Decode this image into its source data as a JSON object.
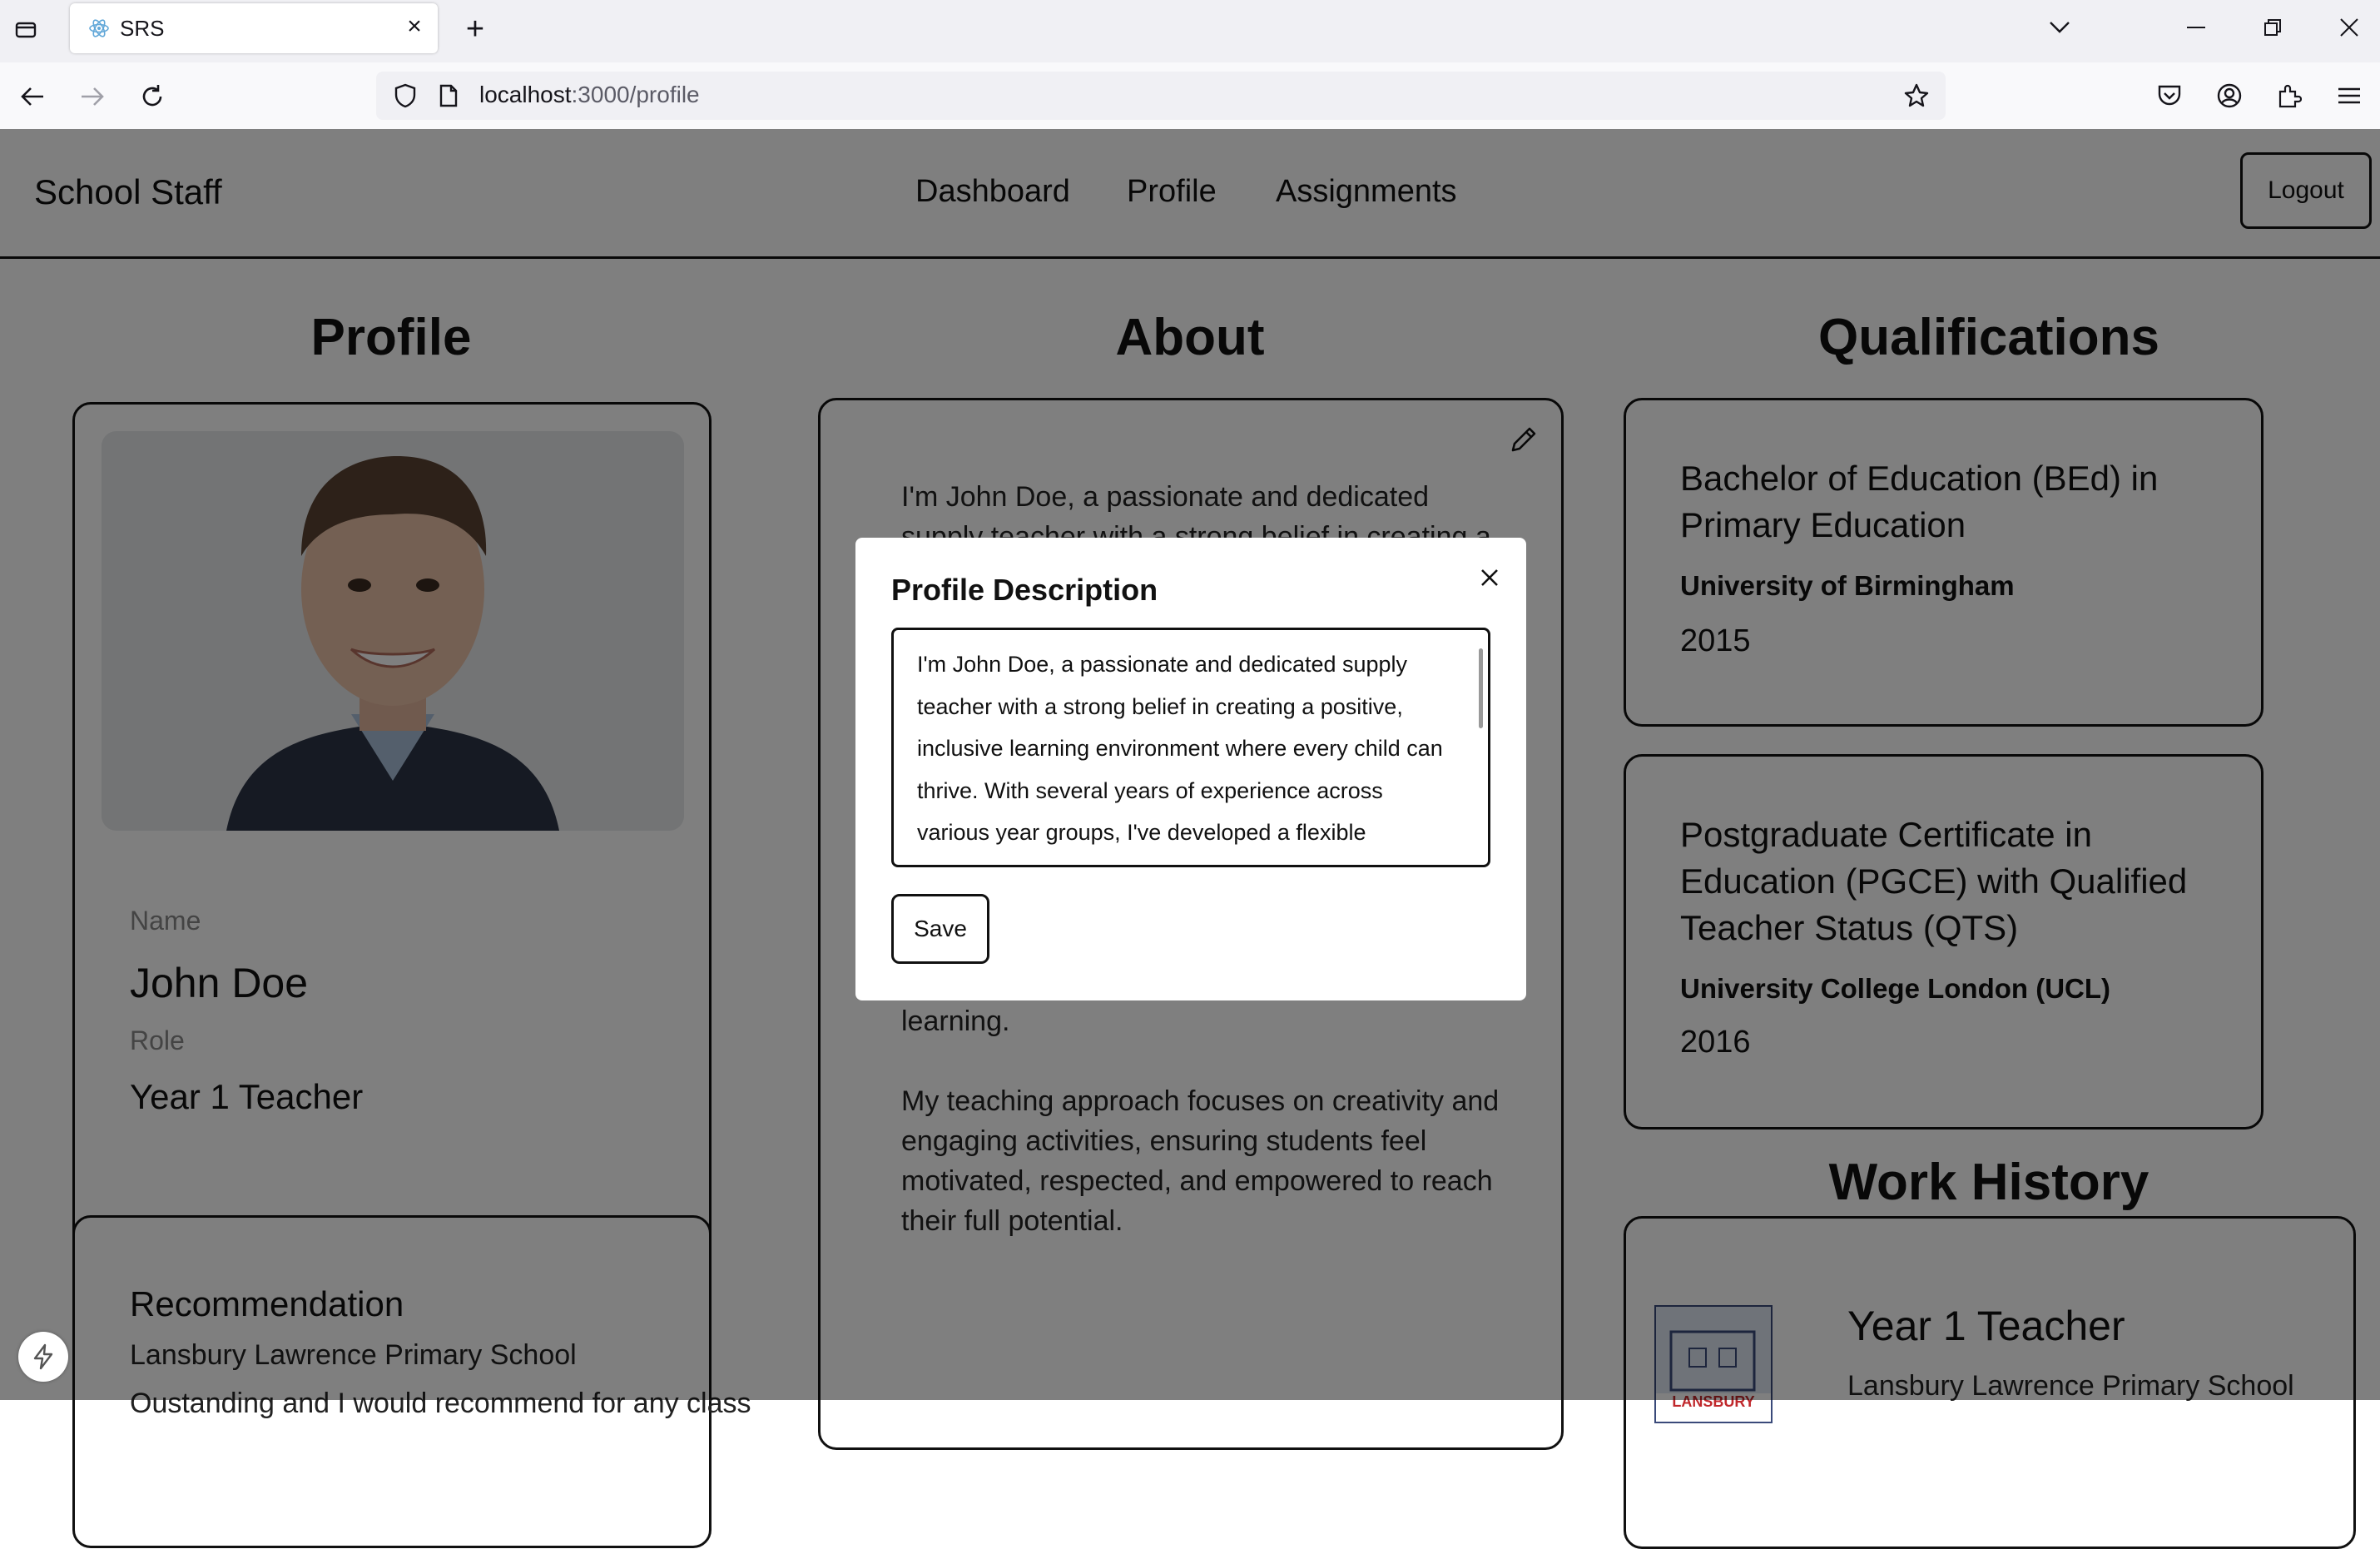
{
  "browser": {
    "tab_title": "SRS",
    "url_host": "localhost",
    "url_path": ":3000/profile"
  },
  "nav": {
    "brand": "School Staff",
    "links": [
      "Dashboard",
      "Profile",
      "Assignments"
    ],
    "logout": "Logout"
  },
  "profile": {
    "heading": "Profile",
    "name_label": "Name",
    "name": "John Doe",
    "role_label": "Role",
    "role": "Year 1 Teacher"
  },
  "recommendation": {
    "heading": "Recommendation",
    "school": "Lansbury Lawrence Primary School",
    "text": "Oustanding and I would recommend for any class"
  },
  "about": {
    "heading": "About",
    "para1_first": "I'm John Doe, a passionate and dedicated",
    "para1_second": "supply teacher with a strong belief in creating a",
    "para1_end": "learning.",
    "para2": "My teaching approach focuses on creativity and engaging activities, ensuring students feel motivated, respected, and empowered to reach their full potential."
  },
  "qualifications": {
    "heading": "Qualifications",
    "items": [
      {
        "title": "Bachelor of Education (BEd) in Primary Education",
        "institution": "University of Birmingham",
        "year": "2015"
      },
      {
        "title": "Postgraduate Certificate in Education (PGCE) with Qualified Teacher Status (QTS)",
        "institution": "University College London (UCL)",
        "year": "2016"
      }
    ]
  },
  "work_history": {
    "heading": "Work History",
    "role": "Year 1 Teacher",
    "school": "Lansbury Lawrence Primary School",
    "logo_text": "LANSBURY"
  },
  "modal": {
    "title": "Profile Description",
    "text": "I'm John Doe, a passionate and dedicated supply teacher with a strong belief in creating a positive, inclusive learning environment where every child can thrive. With several years of experience across various year groups, I've developed a flexible teaching style that allows me to adapt to the unique needs of each classroom."
  },
  "save_label": "Save"
}
